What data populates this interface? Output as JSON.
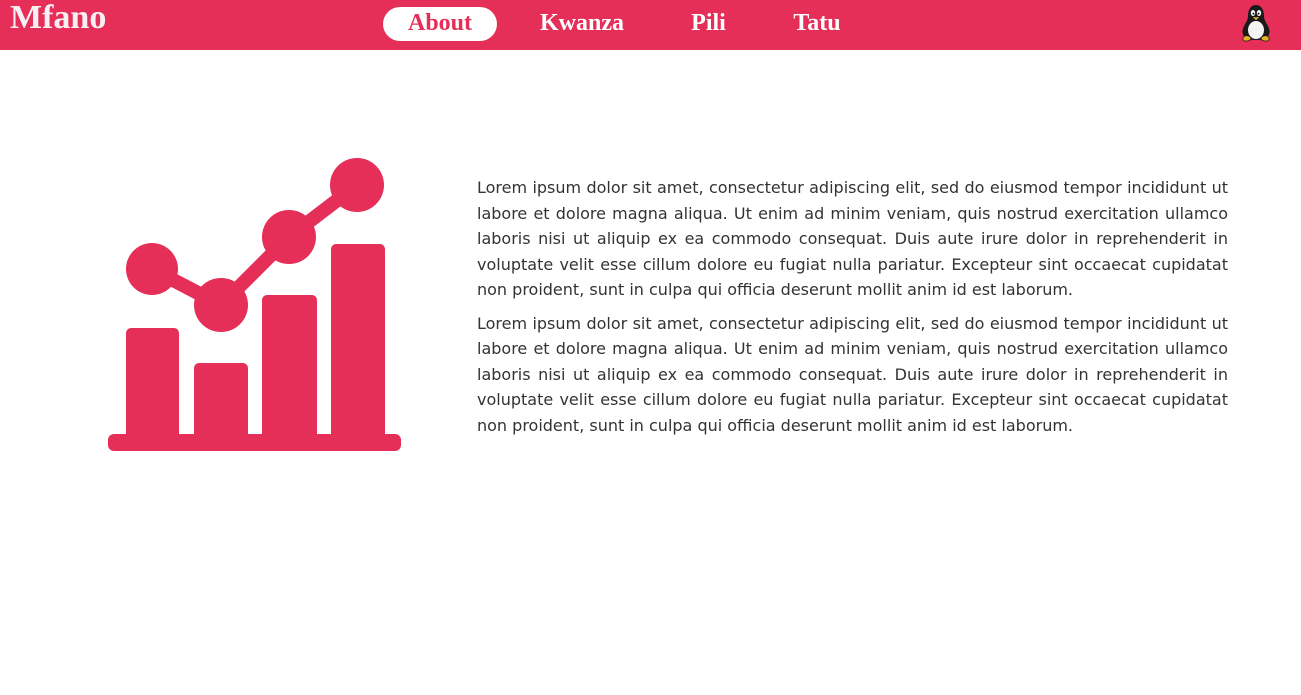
{
  "header": {
    "brand": "Mfano",
    "nav": [
      {
        "label": "About",
        "active": true
      },
      {
        "label": "Kwanza",
        "active": false
      },
      {
        "label": "Pili",
        "active": false
      },
      {
        "label": "Tatu",
        "active": false
      }
    ],
    "logo_icon": "linux-penguin-icon"
  },
  "hero": {
    "icon": "growth-chart-icon",
    "accent_color": "#e52e58"
  },
  "main": {
    "paragraphs": [
      "Lorem ipsum dolor sit amet, consectetur adipiscing elit, sed do eiusmod tempor incididunt ut labore et dolore magna aliqua. Ut enim ad minim veniam, quis nostrud exercitation ullamco laboris nisi ut aliquip ex ea commodo consequat. Duis aute irure dolor in reprehenderit in voluptate velit esse cillum dolore eu fugiat nulla pariatur. Excepteur sint occaecat cupidatat non proident, sunt in culpa qui officia deserunt mollit anim id est laborum.",
      "Lorem ipsum dolor sit amet, consectetur adipiscing elit, sed do eiusmod tempor incididunt ut labore et dolore magna aliqua. Ut enim ad minim veniam, quis nostrud exercitation ullamco laboris nisi ut aliquip ex ea commodo consequat. Duis aute irure dolor in reprehenderit in voluptate velit esse cillum dolore eu fugiat nulla pariatur. Excepteur sint occaecat cupidatat non proident, sunt in culpa qui officia deserunt mollit anim id est laborum."
    ]
  },
  "colors": {
    "primary": "#e52e58",
    "text": "#333333",
    "background": "#ffffff"
  }
}
